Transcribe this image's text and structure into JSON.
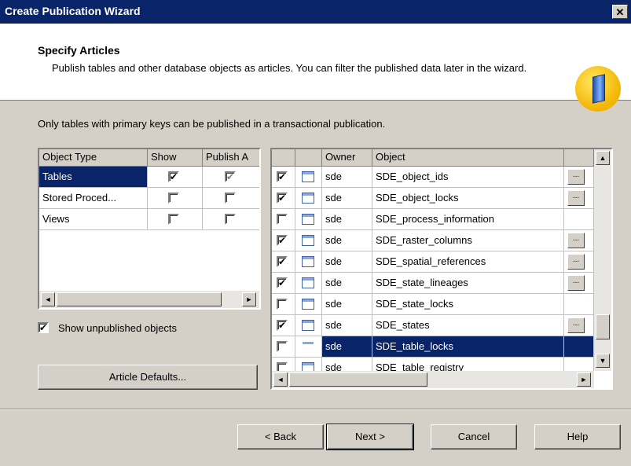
{
  "window": {
    "title": "Create Publication Wizard",
    "close_glyph": "✕"
  },
  "header": {
    "title": "Specify Articles",
    "description": "Publish tables and other database objects as articles. You can filter the published data later in the wizard.",
    "icon": "publication-book-icon"
  },
  "hint": "Only tables with primary keys can be published in a transactional publication.",
  "object_types": {
    "columns": [
      "Object Type",
      "Show",
      "Publish A"
    ],
    "rows": [
      {
        "type": "Tables",
        "show": true,
        "publish": true,
        "selected": true
      },
      {
        "type": "Stored Proced...",
        "show": false,
        "publish": false,
        "selected": false
      },
      {
        "type": "Views",
        "show": false,
        "publish": false,
        "selected": false
      }
    ]
  },
  "show_unpublished": {
    "label": "Show unpublished objects",
    "checked": true
  },
  "article_defaults_label": "Article Defaults...",
  "objects": {
    "columns": [
      "",
      "",
      "Owner",
      "Object",
      ""
    ],
    "rows": [
      {
        "checked": true,
        "owner": "sde",
        "object": "SDE_object_ids",
        "has_props": true,
        "selected": false
      },
      {
        "checked": true,
        "owner": "sde",
        "object": "SDE_object_locks",
        "has_props": true,
        "selected": false
      },
      {
        "checked": false,
        "owner": "sde",
        "object": "SDE_process_information",
        "has_props": false,
        "selected": false
      },
      {
        "checked": true,
        "owner": "sde",
        "object": "SDE_raster_columns",
        "has_props": true,
        "selected": false
      },
      {
        "checked": true,
        "owner": "sde",
        "object": "SDE_spatial_references",
        "has_props": true,
        "selected": false
      },
      {
        "checked": true,
        "owner": "sde",
        "object": "SDE_state_lineages",
        "has_props": true,
        "selected": false
      },
      {
        "checked": false,
        "owner": "sde",
        "object": "SDE_state_locks",
        "has_props": false,
        "selected": false
      },
      {
        "checked": true,
        "owner": "sde",
        "object": "SDE_states",
        "has_props": true,
        "selected": false
      },
      {
        "checked": false,
        "owner": "sde",
        "object": "SDE_table_locks",
        "has_props": false,
        "selected": true
      },
      {
        "checked": false,
        "owner": "sde",
        "object": "SDE_table_registry",
        "has_props": false,
        "selected": false
      }
    ],
    "ellipsis": "..."
  },
  "buttons": {
    "back": "< Back",
    "next": "Next >",
    "cancel": "Cancel",
    "help": "Help"
  },
  "scroll_arrows": {
    "up": "▲",
    "down": "▼",
    "left": "◄",
    "right": "►"
  },
  "colors": {
    "selection": "#0a246a",
    "face": "#d4d0c8"
  }
}
